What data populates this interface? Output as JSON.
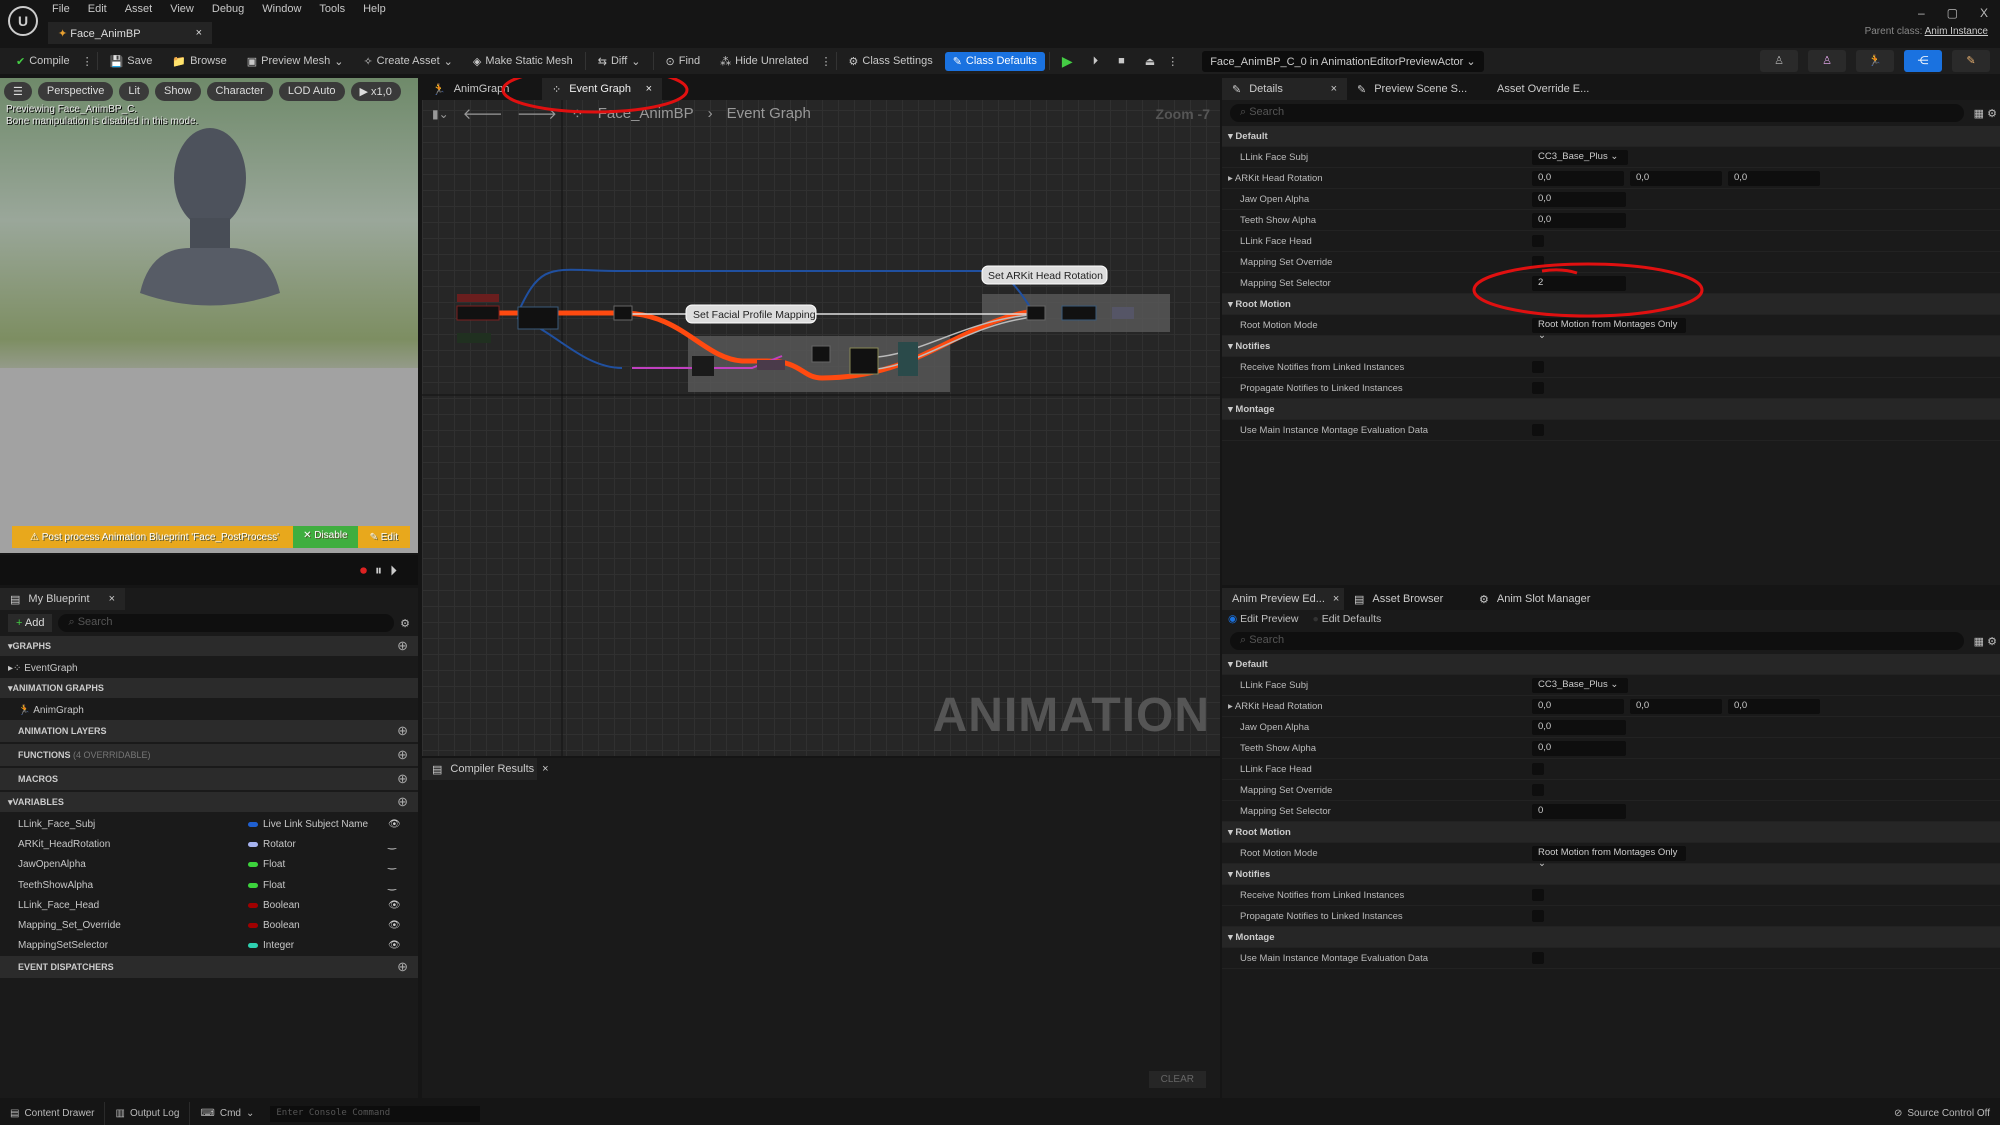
{
  "menu": [
    "File",
    "Edit",
    "Asset",
    "View",
    "Debug",
    "Window",
    "Tools",
    "Help"
  ],
  "doc_tab": "Face_AnimBP",
  "window": {
    "minimize": "–",
    "restore": "▢",
    "close": "X",
    "parent_label": "Parent class:",
    "parent_value": "Anim Instance"
  },
  "toolbar": {
    "compile": "Compile",
    "save": "Save",
    "browse": "Browse",
    "preview_mesh": "Preview Mesh",
    "create_asset": "Create Asset",
    "make_static_mesh": "Make Static Mesh",
    "diff": "Diff",
    "find": "Find",
    "hide_unrelated": "Hide Unrelated",
    "class_settings": "Class Settings",
    "class_defaults": "Class Defaults",
    "debug_actor": "Face_AnimBP_C_0 in AnimationEditorPreviewActor"
  },
  "viewport": {
    "perspective": "Perspective",
    "lit": "Lit",
    "show": "Show",
    "character": "Character",
    "lod": "LOD Auto",
    "speed": "x1,0",
    "info1": "Previewing Face_AnimBP_C.",
    "info2": "Bone manipulation is disabled in this mode.",
    "warning": "Post process Animation Blueprint 'Face_PostProcess'",
    "disable": "✕ Disable",
    "edit": "Edit"
  },
  "my_blueprint": {
    "tab": "My Blueprint",
    "add": "Add",
    "search_placeholder": "Search",
    "graphs": "GRAPHS",
    "event_graph": "EventGraph",
    "animation_graphs": "ANIMATION GRAPHS",
    "anim_graph": "AnimGraph",
    "animation_layers": "ANIMATION LAYERS",
    "functions": "FUNCTIONS",
    "functions_note": "(4 OVERRIDABLE)",
    "macros": "MACROS",
    "variables": "VARIABLES",
    "event_dispatchers": "EVENT DISPATCHERS",
    "vars": [
      {
        "name": "LLink_Face_Subj",
        "type": "Live Link Subject Name",
        "color": "#1f5fd0",
        "icon": "eye-open"
      },
      {
        "name": "ARKit_HeadRotation",
        "type": "Rotator",
        "color": "#a7b4f0",
        "icon": "eye-closed"
      },
      {
        "name": "JawOpenAlpha",
        "type": "Float",
        "color": "#3cd23c",
        "icon": "eye-closed"
      },
      {
        "name": "TeethShowAlpha",
        "type": "Float",
        "color": "#3cd23c",
        "icon": "eye-closed"
      },
      {
        "name": "LLink_Face_Head",
        "type": "Boolean",
        "color": "#a00000",
        "icon": "eye-open"
      },
      {
        "name": "Mapping_Set_Override",
        "type": "Boolean",
        "color": "#a00000",
        "icon": "eye-open"
      },
      {
        "name": "MappingSetSelector",
        "type": "Integer",
        "color": "#2ed0b0",
        "icon": "eye-open"
      }
    ]
  },
  "graph": {
    "tab_anim": "AnimGraph",
    "tab_event": "Event Graph",
    "crumb_root": "Face_AnimBP",
    "crumb_leaf": "Event Graph",
    "zoom": "Zoom -7",
    "watermark": "ANIMATION",
    "comment1": "Set Facial Profile Mapping",
    "comment2": "Set ARKit Head Rotation"
  },
  "compiler": {
    "tab": "Compiler Results",
    "clear": "CLEAR"
  },
  "details": {
    "tabs": [
      "Details",
      "Preview Scene S...",
      "Asset Override E..."
    ],
    "search_placeholder": "Search",
    "default": "Default",
    "llink_face_subj": "LLink Face Subj",
    "subj_value": "CC3_Base_Plus",
    "arkit": "ARKit Head Rotation",
    "rot": [
      "0,0",
      "0,0",
      "0,0"
    ],
    "jaw": "Jaw Open Alpha",
    "jaw_value": "0,0",
    "teeth": "Teeth Show Alpha",
    "teeth_value": "0,0",
    "llink_face_head": "LLink Face Head",
    "override": "Mapping Set Override",
    "selector": "Mapping Set Selector",
    "selector_value": "2",
    "root_motion": "Root Motion",
    "root_motion_mode": "Root Motion Mode",
    "root_motion_value": "Root Motion from Montages Only",
    "notifies": "Notifies",
    "receive": "Receive Notifies from Linked Instances",
    "propagate": "Propagate Notifies to Linked Instances",
    "montage": "Montage",
    "use_main": "Use Main Instance Montage Evaluation Data"
  },
  "preview": {
    "tabs": [
      "Anim Preview Ed...",
      "Asset Browser",
      "Anim Slot Manager"
    ],
    "edit_preview": "Edit Preview",
    "edit_defaults": "Edit Defaults",
    "search_placeholder": "Search",
    "selector_value": "0"
  },
  "status": {
    "content_drawer": "Content Drawer",
    "output_log": "Output Log",
    "cmd": "Cmd",
    "console_placeholder": "Enter Console Command",
    "source_control": "Source Control Off"
  },
  "colors": {
    "accent": "#1a72e0",
    "annotation": "#e01010",
    "exec_wire": "#ff4a10",
    "warning": "#e8a81c"
  }
}
